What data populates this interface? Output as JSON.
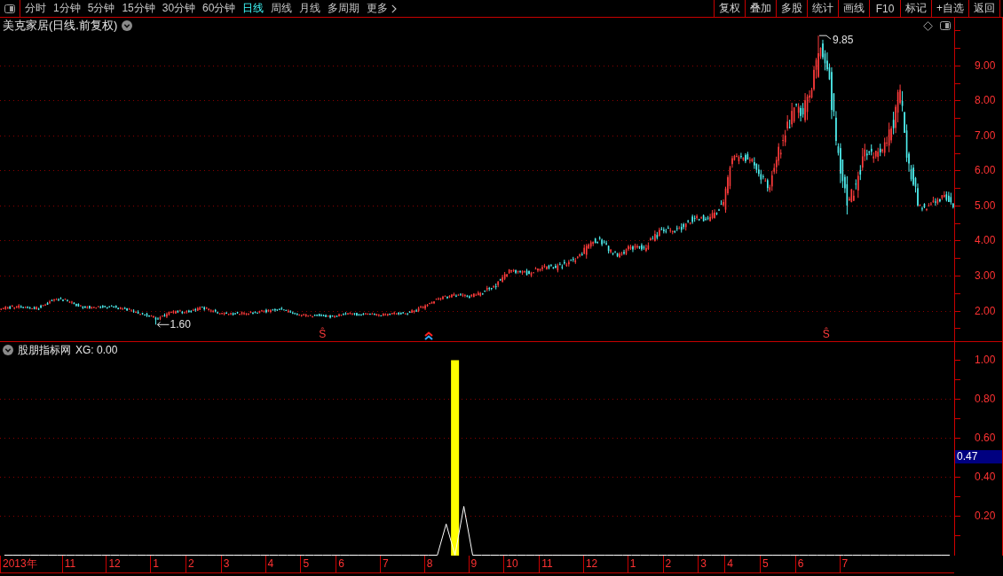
{
  "toolbar": {
    "periods": [
      {
        "label": "分时",
        "kind": "period",
        "selected": false
      },
      {
        "label": "1分钟",
        "kind": "period",
        "selected": false
      },
      {
        "label": "5分钟",
        "kind": "period",
        "selected": false
      },
      {
        "label": "15分钟",
        "kind": "period",
        "selected": false
      },
      {
        "label": "30分钟",
        "kind": "period",
        "selected": false
      },
      {
        "label": "60分钟",
        "kind": "period",
        "selected": false
      },
      {
        "label": "日线",
        "kind": "period",
        "selected": true
      },
      {
        "label": "周线",
        "kind": "period",
        "selected": false
      },
      {
        "label": "月线",
        "kind": "period",
        "selected": false
      },
      {
        "label": "多周期",
        "kind": "period",
        "selected": false
      },
      {
        "label": "更多",
        "kind": "menu",
        "selected": false
      }
    ],
    "actions": [
      "复权",
      "叠加",
      "多股",
      "统计",
      "画线",
      "F10",
      "标记",
      "+自选",
      "返回"
    ]
  },
  "price_panel": {
    "title": "美克家居(日线.前复权)",
    "price_axis": [
      "9.00",
      "8.00",
      "7.00",
      "6.00",
      "5.00",
      "4.00",
      "3.00",
      "2.00"
    ],
    "marks": [
      {
        "kind": "high",
        "text": "9.85"
      },
      {
        "kind": "low",
        "text": "1.60"
      },
      {
        "kind": "letter",
        "text": "Ŝ"
      },
      {
        "kind": "arrow"
      },
      {
        "kind": "letter",
        "text": "Ŝ"
      }
    ]
  },
  "indicator_panel": {
    "name": "股朋指标网",
    "readout": "XG: 0.00",
    "chart_data": {
      "type": "bar",
      "series": [
        {
          "type": "bar",
          "color": "#ffff00",
          "values": [
            0,
            0,
            0,
            0,
            0,
            0,
            0,
            0,
            0,
            0,
            0,
            0,
            0,
            0,
            0,
            0,
            0,
            0,
            0,
            0,
            0,
            0,
            0,
            0,
            0,
            0,
            0,
            0,
            0,
            0,
            0,
            0,
            0,
            0,
            0,
            0,
            0,
            0,
            0,
            0,
            0,
            0,
            0,
            0,
            0,
            0,
            0,
            0,
            0,
            0,
            0,
            1,
            0,
            0,
            0,
            0,
            0,
            0,
            0,
            0,
            0,
            0,
            0,
            0,
            0,
            0,
            0,
            0,
            0,
            0,
            0,
            0,
            0,
            0,
            0,
            0,
            0,
            0,
            0,
            0,
            0,
            0,
            0,
            0,
            0,
            0,
            0,
            0,
            0,
            0,
            0,
            0,
            0,
            0,
            0,
            0,
            0,
            0,
            0,
            0,
            0,
            0,
            0,
            0,
            0,
            0,
            0,
            0
          ]
        },
        {
          "type": "line",
          "color": "#ffffff",
          "values": [
            0,
            0,
            0,
            0,
            0,
            0,
            0,
            0,
            0,
            0,
            0,
            0,
            0,
            0,
            0,
            0,
            0,
            0,
            0,
            0,
            0,
            0,
            0,
            0,
            0,
            0,
            0,
            0,
            0,
            0,
            0,
            0,
            0,
            0,
            0,
            0,
            0,
            0,
            0,
            0,
            0,
            0,
            0,
            0,
            0,
            0,
            0,
            0,
            0,
            0,
            0.16,
            0,
            0.25,
            0,
            0,
            0,
            0,
            0,
            0,
            0,
            0,
            0,
            0,
            0,
            0,
            0,
            0,
            0,
            0,
            0,
            0,
            0,
            0,
            0,
            0,
            0,
            0,
            0,
            0,
            0,
            0,
            0,
            0,
            0,
            0,
            0,
            0,
            0,
            0,
            0,
            0,
            0,
            0,
            0,
            0,
            0,
            0,
            0,
            0,
            0,
            0,
            0,
            0,
            0,
            0,
            0,
            0,
            0
          ]
        }
      ],
      "ylim": [
        0,
        1.093
      ],
      "yticks": [
        {
          "value": 1,
          "label": "1.00"
        },
        {
          "value": 0.8,
          "label": "0.80"
        },
        {
          "value": 0.6,
          "label": "0.60"
        },
        {
          "value": 0.4,
          "label": "0.40"
        },
        {
          "value": 0.2,
          "label": "0.20"
        }
      ],
      "grid": true,
      "annotations": [
        "0.47"
      ]
    }
  },
  "time_axis": [
    "2013年",
    "11",
    "12",
    "1",
    "2",
    "3",
    "4",
    "5",
    "6",
    "7",
    "8",
    "9",
    "10",
    "11",
    "12",
    "1",
    "2",
    "3",
    "4",
    "5",
    "6",
    "7"
  ]
}
